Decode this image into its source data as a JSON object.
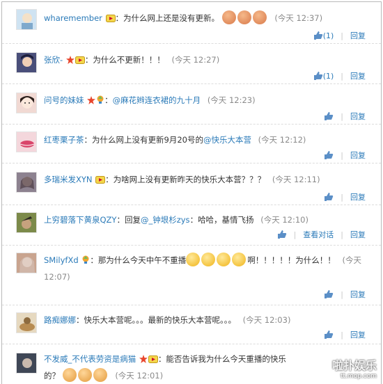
{
  "comments": [
    {
      "user": "wharemember",
      "text": "为什么网上还是没有更新。",
      "time": "(今天 12:37)",
      "likes": "(1)",
      "reply": "回复",
      "emoji_count": 3,
      "avatar_color": "#cfe3f2"
    },
    {
      "user": "张欣-",
      "text": "为什么不更新！！！",
      "time": "(今天 12:27)",
      "likes": "(1)",
      "reply": "回复",
      "avatar_color": "#4a4f7a"
    },
    {
      "user": "问号的妹妹",
      "mention": "@麻花辫连衣裙的九十月",
      "time": "(今天 12:23)",
      "reply": "回复",
      "avatar_color": "#f1d9d3"
    },
    {
      "user": "红枣栗子茶",
      "text": "为什么网上没有更新9月20号的",
      "mention": "@快乐大本营",
      "time": "(今天 12:12)",
      "reply": "回复",
      "avatar_color": "#d9456a"
    },
    {
      "user": "多瑞米发XYN",
      "text": "为啥网上没有更新昨天的快乐大本营？？？",
      "time": "(今天 12:11)",
      "reply": "回复",
      "avatar_color": "#8d8290"
    },
    {
      "user": "上穷碧落下黄泉QZY",
      "reply_prefix": "回复",
      "mention": "@_钟垠杉zys",
      "text": "哈哈，基情飞扬",
      "time": "(今天 12:10)",
      "view_thread": "查看对话",
      "reply": "回复",
      "avatar_color": "#5f6a3e"
    },
    {
      "user": "SMilyfXd",
      "text_a": "那为什么今天中午不重播",
      "text_b": "啊！！！！！为什么！！",
      "time": "(今天 12:07)",
      "reply": "回复",
      "avatar_color": "#c9a48f"
    },
    {
      "user": "路痴娜娜",
      "text": "快乐大本营呢。。。最新的快乐大本营呢。。。",
      "time": "(今天 12:03)",
      "reply": "回复",
      "avatar_color": "#c8b08f"
    },
    {
      "user": "不发威_不代表劳资是病猫",
      "text_a": "能否告诉我为什么今天重播的快乐",
      "text_b": "的？",
      "time": "(今天 12:01)",
      "avatar_color": "#5a6270"
    }
  ],
  "watermark": {
    "title": "啦扑娱乐",
    "site": "tt.mop.com"
  },
  "colors": {
    "link": "#2a7ab8",
    "time": "#8a8a8a"
  }
}
